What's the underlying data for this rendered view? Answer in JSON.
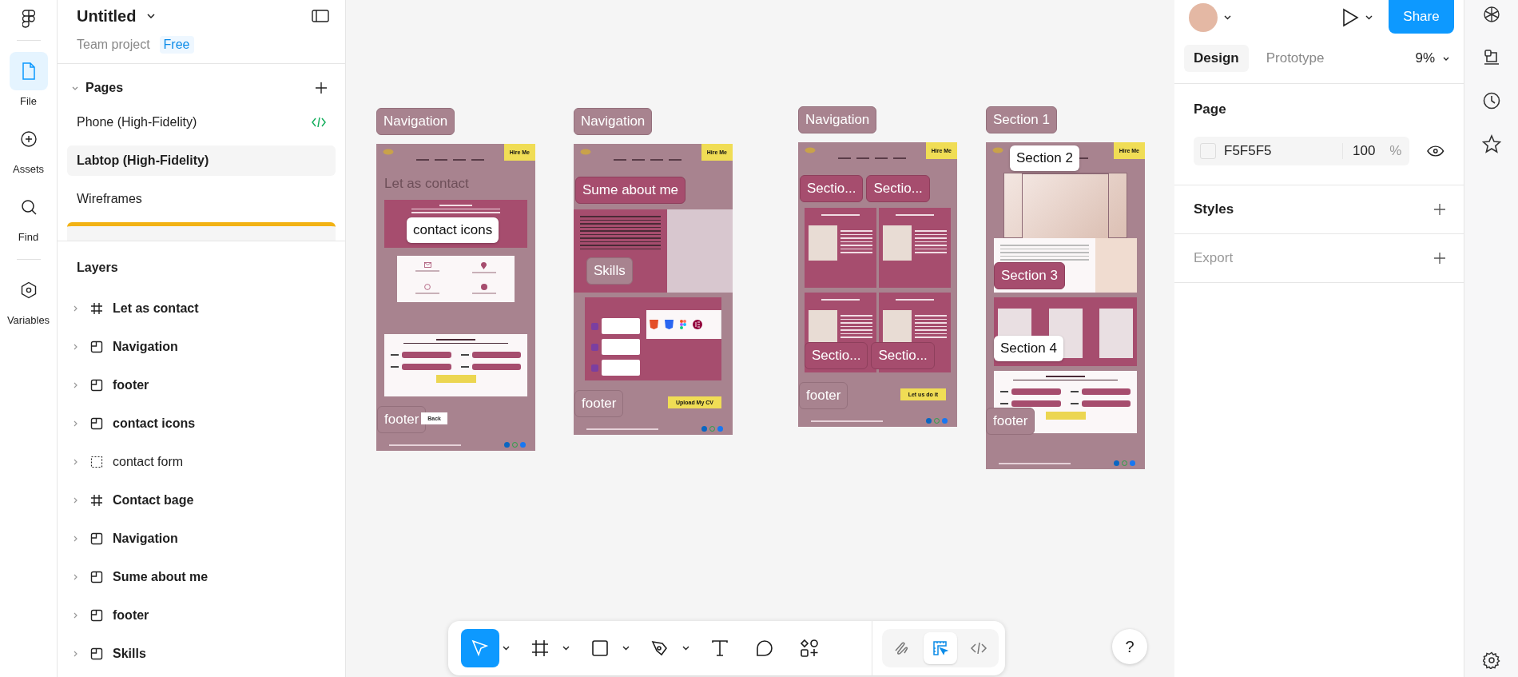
{
  "file": {
    "title": "Untitled",
    "project": "Team project",
    "plan": "Free"
  },
  "rail": [
    {
      "label": "File",
      "selected": true
    },
    {
      "label": "Assets",
      "selected": false
    },
    {
      "label": "Find",
      "selected": false
    },
    {
      "label": "Variables",
      "selected": false
    }
  ],
  "pages": {
    "title": "Pages",
    "items": [
      {
        "name": "Phone (High-Fidelity)",
        "selected": false,
        "dev_ready": true
      },
      {
        "name": "Labtop (High-Fidelity)",
        "selected": true,
        "dev_ready": false
      },
      {
        "name": "Wireframes",
        "selected": false,
        "dev_ready": false
      }
    ]
  },
  "layers": {
    "title": "Layers",
    "items": [
      {
        "name": "Let as contact",
        "kind": "frame"
      },
      {
        "name": "Navigation",
        "kind": "instance"
      },
      {
        "name": "footer",
        "kind": "instance"
      },
      {
        "name": "contact icons",
        "kind": "instance"
      },
      {
        "name": "contact form",
        "kind": "group"
      },
      {
        "name": "Contact bage",
        "kind": "frame"
      },
      {
        "name": "Navigation",
        "kind": "instance"
      },
      {
        "name": "Sume about me",
        "kind": "instance"
      },
      {
        "name": "footer",
        "kind": "instance"
      },
      {
        "name": "Skills",
        "kind": "instance"
      }
    ]
  },
  "frames": [
    {
      "tag": "Navigation",
      "blocks": [
        {
          "kind": "nav",
          "cta": "Hire Me"
        },
        {
          "kind": "title",
          "text": "Let as contact"
        },
        {
          "kind": "banner",
          "tags": [
            "contact icons"
          ]
        },
        {
          "kind": "contacts"
        },
        {
          "kind": "form"
        },
        {
          "kind": "footer",
          "tags": [
            "footer"
          ],
          "cta": "Back"
        }
      ]
    },
    {
      "tag": "Navigation",
      "blocks": [
        {
          "kind": "nav",
          "cta": "Hire Me"
        },
        {
          "kind": "gap",
          "tags": [
            "Sume about me"
          ]
        },
        {
          "kind": "about",
          "tags": [
            "Skills"
          ]
        },
        {
          "kind": "skills"
        },
        {
          "kind": "footer",
          "tags": [
            "footer"
          ],
          "cta": "Upload My CV"
        }
      ]
    },
    {
      "tag": "Navigation",
      "blocks": [
        {
          "kind": "nav",
          "cta": "Hire Me"
        },
        {
          "kind": "gap",
          "tags": [
            "Sectio...",
            "Sectio..."
          ]
        },
        {
          "kind": "projects"
        },
        {
          "kind": "projects",
          "tags": [
            "Sectio...",
            "Sectio..."
          ]
        },
        {
          "kind": "footer",
          "tags": [
            "footer"
          ],
          "cta": "Let us do it"
        }
      ]
    },
    {
      "tag": "Section 1",
      "blocks": [
        {
          "kind": "nav",
          "cta": "Hire Me",
          "tags": [
            "Section 2"
          ]
        },
        {
          "kind": "hero"
        },
        {
          "kind": "intro",
          "tags": [
            "Section 3"
          ]
        },
        {
          "kind": "work",
          "tags": [
            "Section 4"
          ]
        },
        {
          "kind": "form",
          "tags": [
            "footer"
          ]
        },
        {
          "kind": "footer"
        }
      ]
    }
  ],
  "inspector": {
    "share": "Share",
    "tabs": [
      {
        "label": "Design",
        "selected": true
      },
      {
        "label": "Prototype",
        "selected": false
      }
    ],
    "zoom": "9%",
    "page": {
      "title": "Page",
      "fill": "F5F5F5",
      "opacity": "100",
      "unit": "%",
      "visible": true
    },
    "sections": [
      {
        "title": "Styles",
        "disabled": false
      },
      {
        "title": "Export",
        "disabled": true
      }
    ]
  },
  "toolbar": {
    "tools": [
      {
        "kind": "move",
        "selected": true,
        "menu": true
      },
      {
        "kind": "frame",
        "selected": false,
        "menu": true
      },
      {
        "kind": "shape",
        "selected": false,
        "menu": true
      },
      {
        "kind": "pen",
        "selected": false,
        "menu": true
      },
      {
        "kind": "text",
        "selected": false,
        "menu": false
      },
      {
        "kind": "comment",
        "selected": false,
        "menu": false
      },
      {
        "kind": "actions",
        "selected": false,
        "menu": false
      }
    ],
    "modes": [
      {
        "kind": "draw",
        "selected": false
      },
      {
        "kind": "design",
        "selected": true
      },
      {
        "kind": "dev",
        "selected": false
      }
    ]
  },
  "help": "?"
}
